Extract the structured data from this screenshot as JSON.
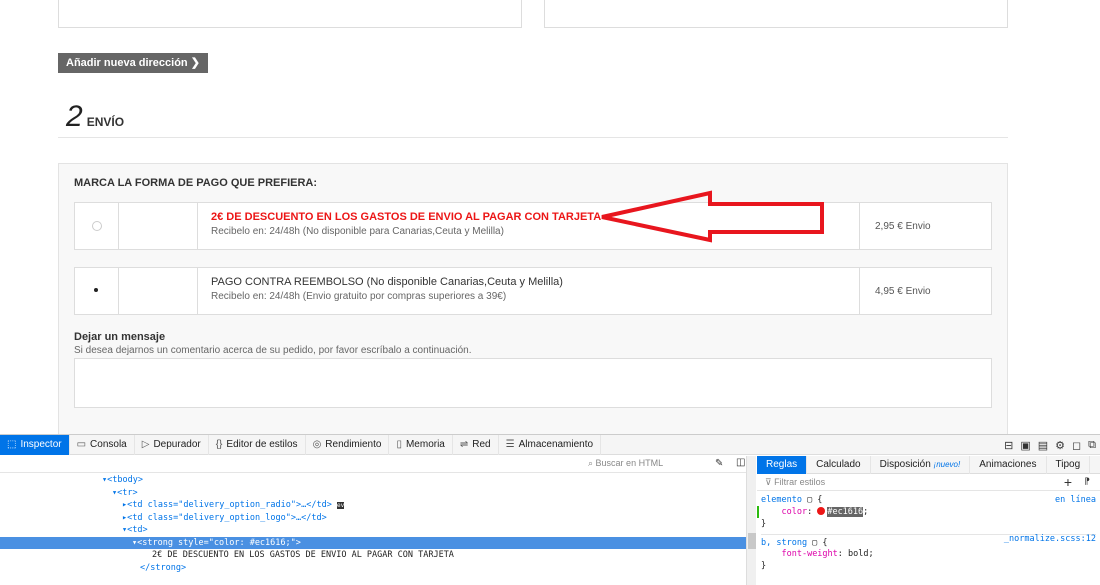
{
  "page": {
    "add_address_button": "Añadir nueva dirección ❯",
    "step_number": "2",
    "step_label": "ENVÍO",
    "payment_heading": "MARCA LA FORMA DE PAGO QUE PREFIERA:",
    "options": [
      {
        "title": "2€ DE DESCUENTO EN LOS GASTOS DE ENVIO AL PAGAR CON TARJETA",
        "subtitle": "Recibelo en: 24/48h (No disponible para Canarias,Ceuta y Melilla)",
        "price": "2,95 € Envio",
        "selected": false,
        "title_color": "#ec1616"
      },
      {
        "title": "PAGO CONTRA REEMBOLSO (No disponible Canarias,Ceuta y Melilla)",
        "subtitle": "Recibelo en: 24/48h (Envio gratuito por compras superiores a 39€)",
        "price": "4,95 € Envio",
        "selected": true
      }
    ],
    "message_label": "Dejar un mensaje",
    "message_hint": "Si desea dejarnos un comentario acerca de su pedido, por favor escríbalo a continuación.",
    "annotation_arrow_color": "#e8161e"
  },
  "devtools": {
    "tabs": [
      {
        "label": "Inspector",
        "icon": "inspector-icon"
      },
      {
        "label": "Consola",
        "icon": "console-icon"
      },
      {
        "label": "Depurador",
        "icon": "debugger-icon"
      },
      {
        "label": "Editor de estilos",
        "icon": "style-editor-icon"
      },
      {
        "label": "Rendimiento",
        "icon": "performance-icon"
      },
      {
        "label": "Memoria",
        "icon": "memory-icon"
      },
      {
        "label": "Red",
        "icon": "network-icon"
      },
      {
        "label": "Almacenamiento",
        "icon": "storage-icon"
      }
    ],
    "search_placeholder": "Buscar en HTML",
    "markup_lines": [
      {
        "text": "▾<tbody>",
        "selected": false
      },
      {
        "text": "▾<tr>",
        "selected": false
      },
      {
        "text": "▸<td class=\"delivery_option_radio\">…</td>",
        "selected": false
      },
      {
        "text": "▸<td class=\"delivery_option_logo\">…</td>",
        "selected": false
      },
      {
        "text": "▾<td>",
        "selected": false
      },
      {
        "text": "▾<strong style=\"color: #ec1616;\">",
        "selected": true
      },
      {
        "text": "2€ DE DESCUENTO EN LOS GASTOS DE ENVIO AL PAGAR CON TARJETA",
        "selected": false
      },
      {
        "text": "</strong>",
        "selected": false
      }
    ],
    "rules_tabs": [
      {
        "label": "Reglas",
        "active": true
      },
      {
        "label": "Calculado",
        "active": false
      },
      {
        "label": "Disposición",
        "badge": "¡nuevo!",
        "active": false
      },
      {
        "label": "Animaciones",
        "active": false
      },
      {
        "label": "Tipog",
        "active": false
      }
    ],
    "filter_placeholder": "Filtrar estilos",
    "rules": {
      "rule1_selector": "elemento",
      "rule1_source": "en línea",
      "rule1_prop": "color",
      "rule1_value": "#ec1616",
      "rule2_selector": "b, strong",
      "rule2_source": "_normalize.scss:12",
      "rule2_prop": "font-weight",
      "rule2_value": "bold"
    }
  }
}
